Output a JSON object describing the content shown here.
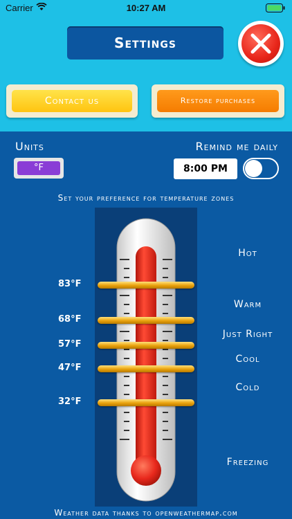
{
  "status_bar": {
    "carrier": "Carrier",
    "time": "10:27 AM",
    "wifi_icon": "wifi-icon",
    "battery_icon": "battery-icon"
  },
  "header": {
    "title": "Settings",
    "close_icon": "close-icon"
  },
  "actions": {
    "contact_label": "Contact us",
    "restore_label": "Restore purchases"
  },
  "units": {
    "label": "Units",
    "value": "°F"
  },
  "remind": {
    "label": "Remind me daily",
    "time": "8:00 PM",
    "enabled": false
  },
  "zones": {
    "instruction": "Set your preference for temperature zones",
    "thresholds": [
      "83°F",
      "68°F",
      "57°F",
      "47°F",
      "32°F"
    ],
    "names": [
      "Hot",
      "Warm",
      "Just Right",
      "Cool",
      "Cold",
      "Freezing"
    ]
  },
  "footer": {
    "credit": "Weather data thanks to openweathermap.com"
  },
  "colors": {
    "top_bg": "#1ec0e6",
    "main_bg": "#0b5aa3",
    "contact": "#ffc410",
    "restore": "#f57c00",
    "unit_toggle": "#8a3dd6",
    "close": "#e8261a",
    "mercury": "#e8281c",
    "slider": "#f2b51a"
  }
}
